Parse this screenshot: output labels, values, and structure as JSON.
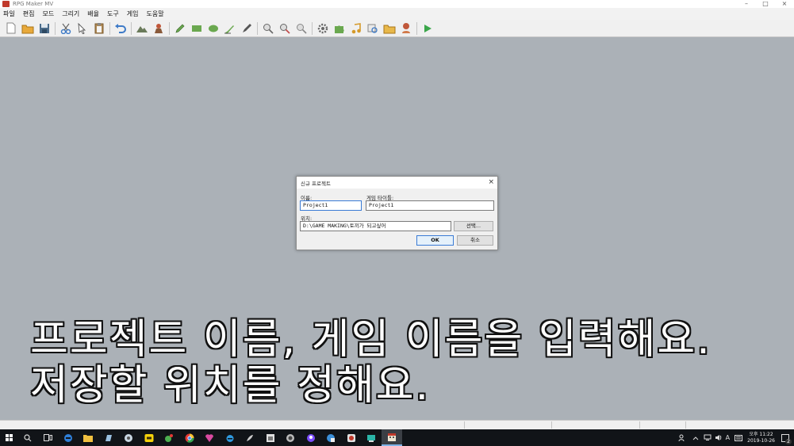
{
  "window": {
    "title": "RPG Maker MV",
    "controls": [
      "–",
      "□",
      "×"
    ]
  },
  "menu": [
    "파일",
    "편집",
    "모드",
    "그리기",
    "배율",
    "도구",
    "게임",
    "도움말"
  ],
  "toolbar": {
    "icons": [
      "new-project-icon",
      "open-project-icon",
      "save-project-icon",
      "cut-icon",
      "copy-icon",
      "paste-icon",
      "undo-icon",
      "map-mode-icon",
      "event-mode-icon",
      "pencil-icon",
      "rectangle-icon",
      "ellipse-icon",
      "flood-fill-icon",
      "shadow-pen-icon",
      "zoom-in-icon",
      "zoom-out-icon",
      "actual-size-icon",
      "database-icon",
      "plugin-manager-icon",
      "sound-test-icon",
      "event-searcher-icon",
      "resource-manager-icon",
      "character-generator-icon",
      "playtest-icon"
    ]
  },
  "dialog": {
    "title": "신규 프로젝트",
    "close_glyph": "×",
    "name_label": "이름:",
    "name_value": "Project1",
    "game_title_label": "게임 타이틀:",
    "game_title_value": "Project1",
    "location_label": "위치:",
    "location_value": "D:\\GAME MAKING\\토끼가 되고싶어",
    "choose_label": "선택...",
    "ok_label": "OK",
    "cancel_label": "취소"
  },
  "subtitle": {
    "line1": "프로젝트 이름, 게임 이름을 입력해요.",
    "line2": "저장할 위치를 정해요."
  },
  "taskbar": {
    "icons": [
      "search-icon",
      "task-view-icon",
      "edge-icon",
      "file-explorer-icon",
      "app-icon-1",
      "app-icon-2",
      "kakaotalk-icon",
      "app-icon-3",
      "chrome-icon",
      "app-icon-4",
      "ie-icon",
      "app-icon-5",
      "app-icon-6",
      "app-icon-7",
      "app-icon-8",
      "app-icon-9",
      "app-icon-10",
      "app-icon-11",
      "rpg-maker-icon"
    ],
    "tray_ime": "A",
    "clock_time": "오후 11:22",
    "clock_date": "2019-10-26",
    "notification_count": "2"
  },
  "colors": {
    "workarea": "#abb1b7",
    "taskbar": "#111418",
    "accent": "#3a7bd5"
  }
}
